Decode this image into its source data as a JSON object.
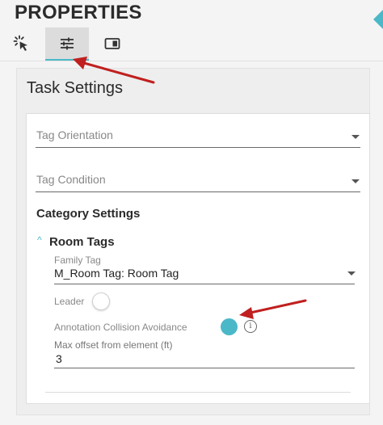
{
  "header": {
    "title": "PROPERTIES"
  },
  "tabs": [
    {
      "name": "select",
      "icon": "cursor-click-icon",
      "active": false
    },
    {
      "name": "settings",
      "icon": "sliders-icon",
      "active": true
    },
    {
      "name": "panel",
      "icon": "panel-icon",
      "active": false
    }
  ],
  "task_settings": {
    "title": "Task Settings",
    "tag_orientation": {
      "placeholder": "Tag Orientation",
      "value": ""
    },
    "tag_condition": {
      "placeholder": "Tag Condition",
      "value": ""
    }
  },
  "category_settings": {
    "title": "Category Settings",
    "room_tags": {
      "label": "Room Tags",
      "expanded": true,
      "family_tag": {
        "label": "Family Tag",
        "value": "M_Room Tag: Room Tag"
      },
      "leader": {
        "label": "Leader",
        "on": false
      },
      "annotation_collision_avoidance": {
        "label": "Annotation Collision Avoidance",
        "on": true
      },
      "max_offset": {
        "label": "Max offset from element (ft)",
        "value": "3"
      }
    }
  },
  "colors": {
    "accent": "#4bb8c8",
    "annotation_arrow": "#c0201f"
  }
}
